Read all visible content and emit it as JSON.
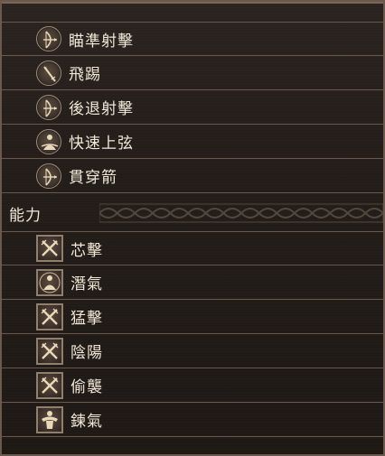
{
  "skills_section": {
    "items": [
      {
        "label": "瞄準射擊",
        "icon": "bow-icon"
      },
      {
        "label": "飛踢",
        "icon": "spear-icon"
      },
      {
        "label": "後退射擊",
        "icon": "bow-icon"
      },
      {
        "label": "快速上弦",
        "icon": "meditation-icon"
      },
      {
        "label": "貫穿箭",
        "icon": "bow-icon"
      }
    ]
  },
  "abilities_section": {
    "title": "能力",
    "items": [
      {
        "label": "芯擊",
        "icon": "crossed-swords-icon"
      },
      {
        "label": "潛氣",
        "icon": "meditation-icon"
      },
      {
        "label": "猛擊",
        "icon": "crossed-swords-icon"
      },
      {
        "label": "陰陽",
        "icon": "crossed-swords-icon"
      },
      {
        "label": "偷襲",
        "icon": "crossed-swords-icon"
      },
      {
        "label": "鍊氣",
        "icon": "muscle-icon"
      }
    ]
  },
  "colors": {
    "background": "#231c19",
    "divider": "#6a584c",
    "text": "#f0e7d7",
    "icon_border": "#9c8d79"
  }
}
